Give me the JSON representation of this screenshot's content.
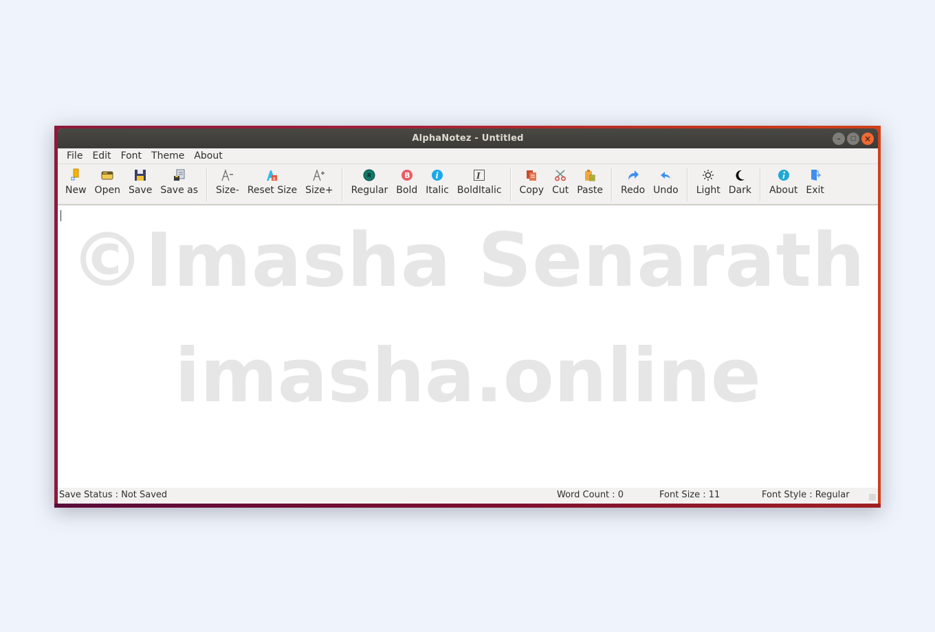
{
  "window": {
    "title": "AlphaNotez - Untitled",
    "controls": {
      "minimize": "–",
      "maximize": "▢",
      "close": "×"
    }
  },
  "menubar": [
    "File",
    "Edit",
    "Font",
    "Theme",
    "About"
  ],
  "toolbar": {
    "groups": [
      [
        {
          "label": "New",
          "icon": "new-file-icon"
        },
        {
          "label": "Open",
          "icon": "open-folder-icon"
        },
        {
          "label": "Save",
          "icon": "floppy-save-icon"
        },
        {
          "label": "Save as",
          "icon": "save-as-icon"
        }
      ],
      [
        {
          "label": "Size-",
          "icon": "font-size-decrease-icon"
        },
        {
          "label": "Reset Size",
          "icon": "font-size-reset-icon"
        },
        {
          "label": "Size+",
          "icon": "font-size-increase-icon"
        }
      ],
      [
        {
          "label": "Regular",
          "icon": "regular-style-icon"
        },
        {
          "label": "Bold",
          "icon": "bold-style-icon"
        },
        {
          "label": "Italic",
          "icon": "italic-style-icon"
        },
        {
          "label": "BoldItalic",
          "icon": "bold-italic-style-icon"
        }
      ],
      [
        {
          "label": "Copy",
          "icon": "copy-icon"
        },
        {
          "label": "Cut",
          "icon": "scissors-cut-icon"
        },
        {
          "label": "Paste",
          "icon": "paste-clipboard-icon"
        }
      ],
      [
        {
          "label": "Redo",
          "icon": "redo-arrow-icon"
        },
        {
          "label": "Undo",
          "icon": "undo-arrow-icon"
        }
      ],
      [
        {
          "label": "Light",
          "icon": "sun-light-theme-icon"
        },
        {
          "label": "Dark",
          "icon": "moon-dark-theme-icon"
        }
      ],
      [
        {
          "label": "About",
          "icon": "info-icon"
        },
        {
          "label": "Exit",
          "icon": "exit-door-icon"
        }
      ]
    ]
  },
  "editor": {
    "content": "",
    "watermark_line1": "©Imasha Senarath",
    "watermark_line2": "imasha.online"
  },
  "statusbar": {
    "save_status": "Save Status : Not Saved",
    "word_count": "Word Count : 0",
    "font_size": "Font Size : 11",
    "font_style": "Font Style : Regular"
  },
  "colors": {
    "titlebar": "#3c3b37",
    "close_button": "#ef6a35",
    "watermark": "#e6e6e6",
    "background": "#eff3fb"
  }
}
